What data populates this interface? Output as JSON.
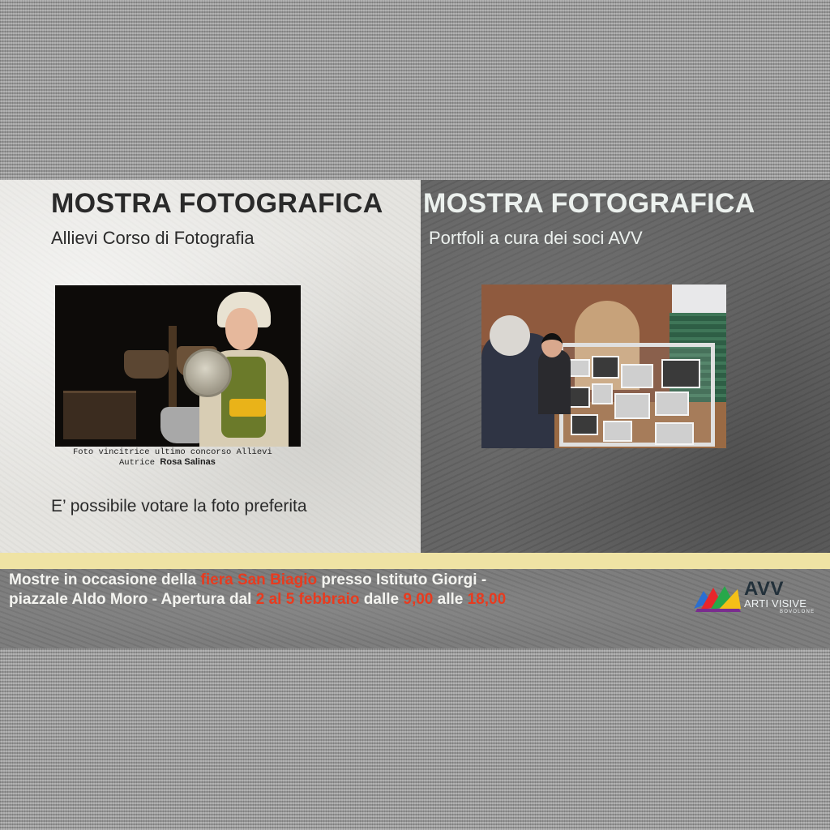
{
  "left_panel": {
    "title": "MOSTRA FOTOGRAFICA",
    "subtitle": "Allievi Corso di Fotografia",
    "caption_line1": "Foto vincitrice ultimo concorso Allievi",
    "caption_author_prefix": "Autrice",
    "caption_author_name": "Rosa Salinas",
    "vote_text": "E’ possibile votare la foto preferita"
  },
  "right_panel": {
    "title": "MOSTRA FOTOGRAFICA",
    "subtitle": "Portfoli a cura dei soci AVV"
  },
  "band": {
    "line1_a": "Mostre in occasione della ",
    "line1_b": "fiera San Biagio",
    "line1_c": " presso Istituto Giorgi -",
    "line2_a": "piazzale Aldo Moro - Apertura dal ",
    "line2_b": "2 al 5 febbraio",
    "line2_c": " dalle ",
    "line2_d": "9,00",
    "line2_e": " alle ",
    "line2_f": "18,00"
  },
  "logo": {
    "name": "AVV",
    "subtitle": "ARTI VISIVE",
    "town": "BOVOLONE"
  },
  "colors": {
    "highlight_red": "#e83b1f",
    "strip_yellow": "#efe3a4",
    "dark_panel": "#616161",
    "light_panel": "#e4e3df"
  }
}
